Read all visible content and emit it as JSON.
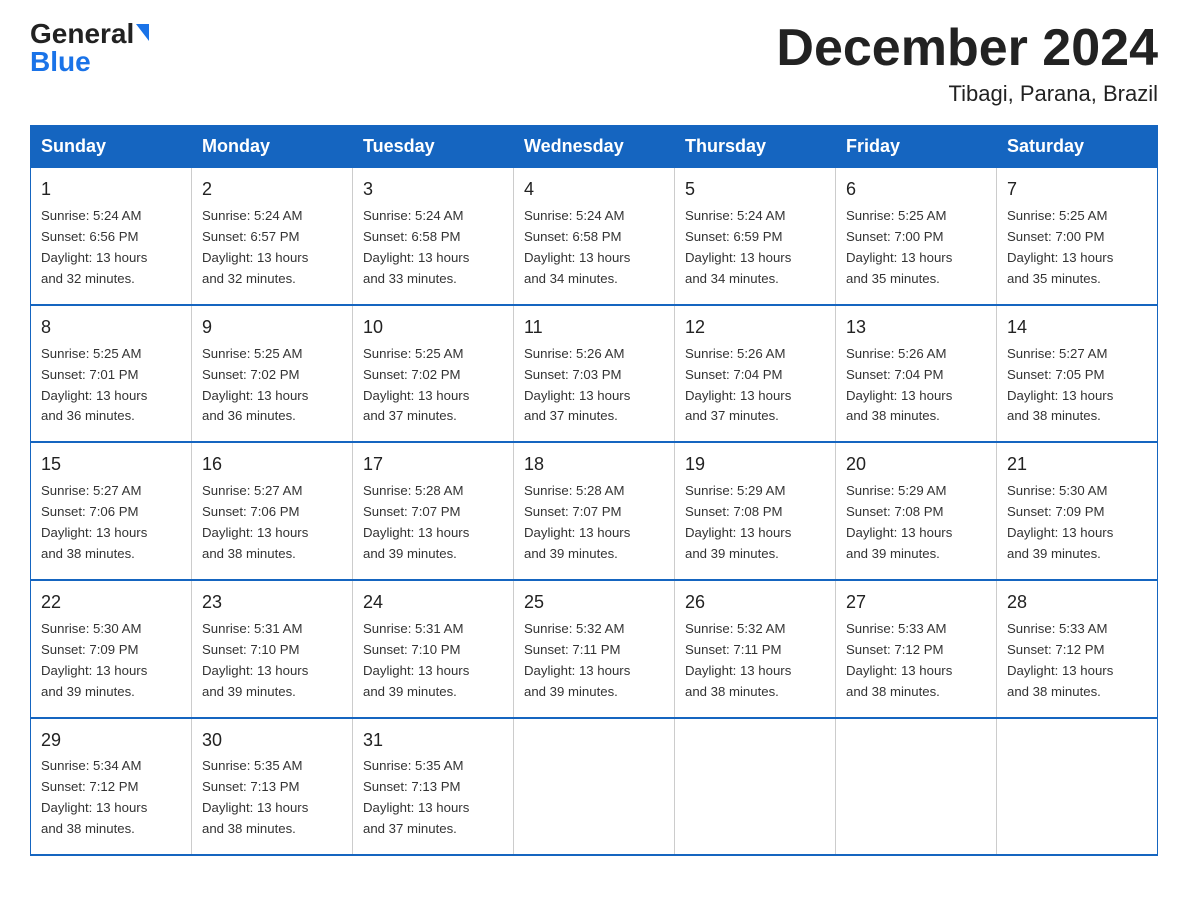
{
  "logo": {
    "general": "General",
    "blue": "Blue"
  },
  "title": "December 2024",
  "location": "Tibagi, Parana, Brazil",
  "days_of_week": [
    "Sunday",
    "Monday",
    "Tuesday",
    "Wednesday",
    "Thursday",
    "Friday",
    "Saturday"
  ],
  "weeks": [
    [
      {
        "day": "1",
        "sunrise": "5:24 AM",
        "sunset": "6:56 PM",
        "daylight": "13 hours and 32 minutes."
      },
      {
        "day": "2",
        "sunrise": "5:24 AM",
        "sunset": "6:57 PM",
        "daylight": "13 hours and 32 minutes."
      },
      {
        "day": "3",
        "sunrise": "5:24 AM",
        "sunset": "6:58 PM",
        "daylight": "13 hours and 33 minutes."
      },
      {
        "day": "4",
        "sunrise": "5:24 AM",
        "sunset": "6:58 PM",
        "daylight": "13 hours and 34 minutes."
      },
      {
        "day": "5",
        "sunrise": "5:24 AM",
        "sunset": "6:59 PM",
        "daylight": "13 hours and 34 minutes."
      },
      {
        "day": "6",
        "sunrise": "5:25 AM",
        "sunset": "7:00 PM",
        "daylight": "13 hours and 35 minutes."
      },
      {
        "day": "7",
        "sunrise": "5:25 AM",
        "sunset": "7:00 PM",
        "daylight": "13 hours and 35 minutes."
      }
    ],
    [
      {
        "day": "8",
        "sunrise": "5:25 AM",
        "sunset": "7:01 PM",
        "daylight": "13 hours and 36 minutes."
      },
      {
        "day": "9",
        "sunrise": "5:25 AM",
        "sunset": "7:02 PM",
        "daylight": "13 hours and 36 minutes."
      },
      {
        "day": "10",
        "sunrise": "5:25 AM",
        "sunset": "7:02 PM",
        "daylight": "13 hours and 37 minutes."
      },
      {
        "day": "11",
        "sunrise": "5:26 AM",
        "sunset": "7:03 PM",
        "daylight": "13 hours and 37 minutes."
      },
      {
        "day": "12",
        "sunrise": "5:26 AM",
        "sunset": "7:04 PM",
        "daylight": "13 hours and 37 minutes."
      },
      {
        "day": "13",
        "sunrise": "5:26 AM",
        "sunset": "7:04 PM",
        "daylight": "13 hours and 38 minutes."
      },
      {
        "day": "14",
        "sunrise": "5:27 AM",
        "sunset": "7:05 PM",
        "daylight": "13 hours and 38 minutes."
      }
    ],
    [
      {
        "day": "15",
        "sunrise": "5:27 AM",
        "sunset": "7:06 PM",
        "daylight": "13 hours and 38 minutes."
      },
      {
        "day": "16",
        "sunrise": "5:27 AM",
        "sunset": "7:06 PM",
        "daylight": "13 hours and 38 minutes."
      },
      {
        "day": "17",
        "sunrise": "5:28 AM",
        "sunset": "7:07 PM",
        "daylight": "13 hours and 39 minutes."
      },
      {
        "day": "18",
        "sunrise": "5:28 AM",
        "sunset": "7:07 PM",
        "daylight": "13 hours and 39 minutes."
      },
      {
        "day": "19",
        "sunrise": "5:29 AM",
        "sunset": "7:08 PM",
        "daylight": "13 hours and 39 minutes."
      },
      {
        "day": "20",
        "sunrise": "5:29 AM",
        "sunset": "7:08 PM",
        "daylight": "13 hours and 39 minutes."
      },
      {
        "day": "21",
        "sunrise": "5:30 AM",
        "sunset": "7:09 PM",
        "daylight": "13 hours and 39 minutes."
      }
    ],
    [
      {
        "day": "22",
        "sunrise": "5:30 AM",
        "sunset": "7:09 PM",
        "daylight": "13 hours and 39 minutes."
      },
      {
        "day": "23",
        "sunrise": "5:31 AM",
        "sunset": "7:10 PM",
        "daylight": "13 hours and 39 minutes."
      },
      {
        "day": "24",
        "sunrise": "5:31 AM",
        "sunset": "7:10 PM",
        "daylight": "13 hours and 39 minutes."
      },
      {
        "day": "25",
        "sunrise": "5:32 AM",
        "sunset": "7:11 PM",
        "daylight": "13 hours and 39 minutes."
      },
      {
        "day": "26",
        "sunrise": "5:32 AM",
        "sunset": "7:11 PM",
        "daylight": "13 hours and 38 minutes."
      },
      {
        "day": "27",
        "sunrise": "5:33 AM",
        "sunset": "7:12 PM",
        "daylight": "13 hours and 38 minutes."
      },
      {
        "day": "28",
        "sunrise": "5:33 AM",
        "sunset": "7:12 PM",
        "daylight": "13 hours and 38 minutes."
      }
    ],
    [
      {
        "day": "29",
        "sunrise": "5:34 AM",
        "sunset": "7:12 PM",
        "daylight": "13 hours and 38 minutes."
      },
      {
        "day": "30",
        "sunrise": "5:35 AM",
        "sunset": "7:13 PM",
        "daylight": "13 hours and 38 minutes."
      },
      {
        "day": "31",
        "sunrise": "5:35 AM",
        "sunset": "7:13 PM",
        "daylight": "13 hours and 37 minutes."
      },
      null,
      null,
      null,
      null
    ]
  ],
  "labels": {
    "sunrise": "Sunrise:",
    "sunset": "Sunset:",
    "daylight": "Daylight:"
  },
  "colors": {
    "header_bg": "#1565c0",
    "header_text": "#ffffff",
    "border": "#1565c0"
  }
}
